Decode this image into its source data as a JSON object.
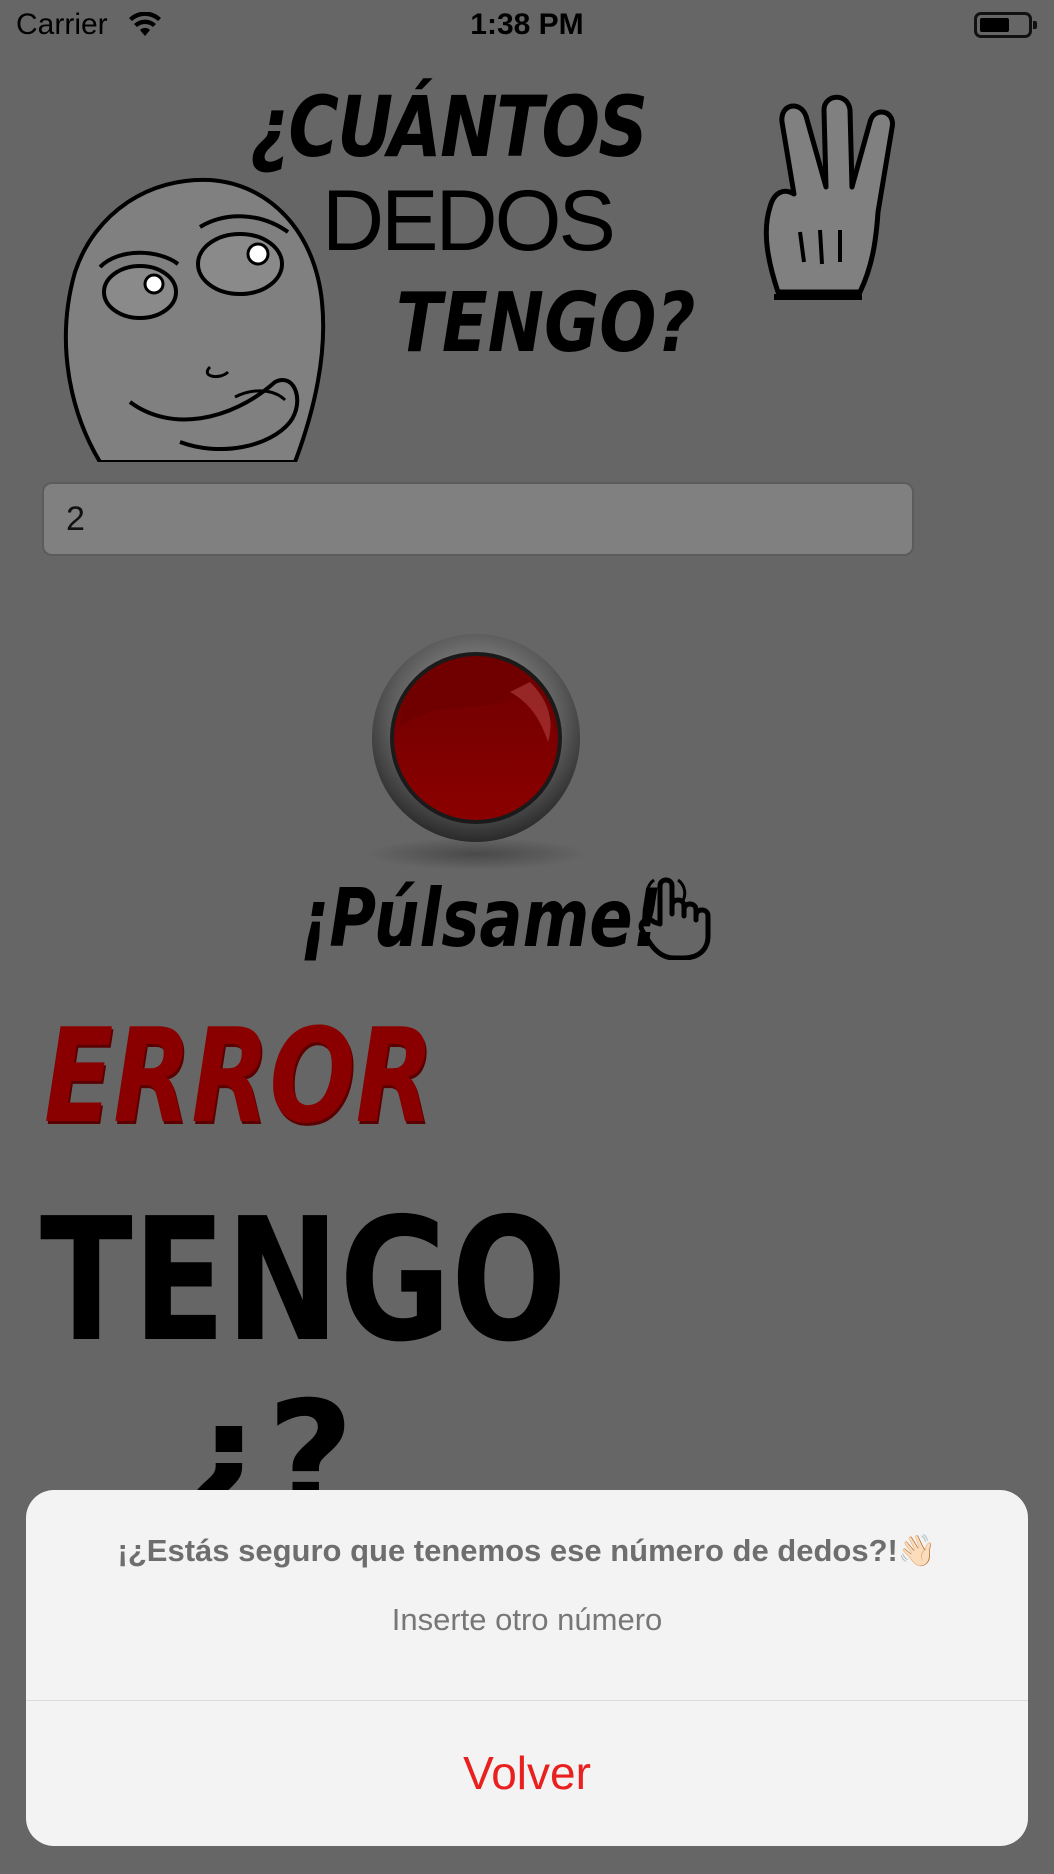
{
  "status_bar": {
    "carrier": "Carrier",
    "time": "1:38 PM",
    "battery_level": 0.55
  },
  "header": {
    "title_line_1": "¿CUÁNTOS",
    "title_line_2": "DEDOS",
    "title_line_3": "TENGO?",
    "face_icon": "thinking-face-icon",
    "hand_icon": "three-fingers-hand-icon"
  },
  "input": {
    "value": "2"
  },
  "press_button": {
    "label": "¡Púlsame!",
    "icon": "pointing-hand-icon",
    "color": "#8b0000"
  },
  "result": {
    "status": "ERROR",
    "status_color": "#8a0000",
    "line_1": "TENGO",
    "line_2": "¿?"
  },
  "alert": {
    "title": "¡¿Estás seguro que tenemos ese número de dedos?!👋🏻",
    "message": "Inserte otro número",
    "button_label": "Volver",
    "button_color": "#e8201e"
  }
}
